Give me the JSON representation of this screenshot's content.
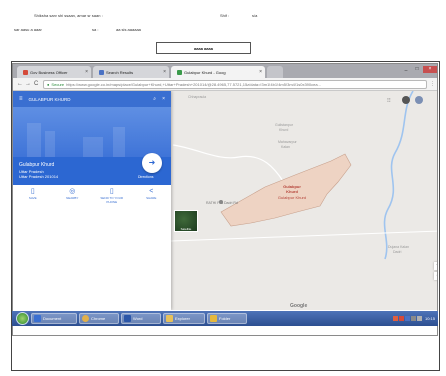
{
  "doc": {
    "line1_left": "Shiksha sarv shi ssaan, amar sr saan :",
    "line1_mid": "Shif :",
    "line1_right": "s/a",
    "line2_left": "sar aasu a aaar",
    "line2_mid": "sa :",
    "line2_right": "aa sis aaaaaa",
    "submit_label": "aaaa aaaa"
  },
  "browser": {
    "tabs": [
      {
        "label": "Gov Business Officer",
        "color": "#d44a3a"
      },
      {
        "label": "Search Results",
        "color": "#4a72c4"
      },
      {
        "label": "Gulabpur Khurd - Goog",
        "color": "#3a9a4a"
      }
    ],
    "window_controls": [
      "_",
      "□",
      "×"
    ],
    "secure_label": "Secure",
    "url": "https://www.google.co.in/maps/place/Gulabpur+Khurd,+Uttar+Pradesh+201014/@28.4965,77.5721,15z/data=!3m1!4b1!4m5!3m4!1s0x390cea...",
    "nav_back": "←",
    "nav_forward": "→",
    "nav_reload": "C"
  },
  "map": {
    "search_text": "GULABPUR KHURD",
    "place_name": "Gulabpur Khurd",
    "place_sub1": "Uttar Pradesh",
    "place_sub2": "Uttar Pradesh 201014",
    "directions_label": "Directions",
    "actions": [
      {
        "icon": "save-icon",
        "glyph": "▯",
        "label": "SAVE"
      },
      {
        "icon": "nearby-icon",
        "glyph": "◎",
        "label": "NEARBY"
      },
      {
        "icon": "phone-icon",
        "glyph": "▯",
        "label": "SEND TO YOUR PHONE"
      },
      {
        "icon": "share-icon",
        "glyph": "<",
        "label": "SHARE"
      }
    ],
    "labels": {
      "top_center": "Chhapraula",
      "top_right1": "Gulistanpur",
      "top_right2": "Khurd",
      "mid_right1": "Mahavarpur",
      "mid_right2": "Kalan",
      "bottom_right1": "Dujana Kalan",
      "bottom_right2": "Dadri",
      "landmark": "RATHI Flat Dadri Rd",
      "region1": "Gulabpur",
      "region2": "Khurd",
      "region3": "Gulabpur Khurd"
    },
    "satellite_label": "Satellite",
    "google_label": "Google",
    "zoom_in": "+",
    "zoom_out": "−"
  },
  "taskbar": {
    "items": [
      {
        "label": "Document",
        "color": "#3a6fd1"
      },
      {
        "label": "Chrome",
        "color": "#e2b04a"
      },
      {
        "label": "Word",
        "color": "#2b56a8"
      },
      {
        "label": "Explorer",
        "color": "#e7c15a"
      },
      {
        "label": "Folder",
        "color": "#e5b83d"
      }
    ],
    "time": "10:15"
  }
}
